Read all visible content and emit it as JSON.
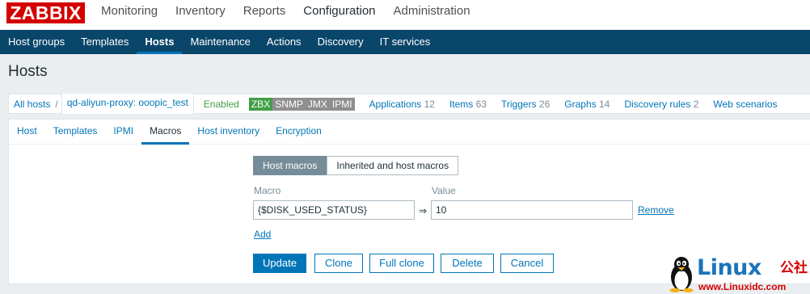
{
  "logo": "ZABBIX",
  "main_menu": [
    "Monitoring",
    "Inventory",
    "Reports",
    "Configuration",
    "Administration"
  ],
  "main_menu_active": "Configuration",
  "sub_menu": [
    "Host groups",
    "Templates",
    "Hosts",
    "Maintenance",
    "Actions",
    "Discovery",
    "IT services"
  ],
  "sub_menu_active": "Hosts",
  "page_title": "Hosts",
  "host_nav": {
    "all_hosts": "All hosts",
    "separator": "/",
    "host_name": "qd-aliyun-proxy: ooopic_test",
    "status": "Enabled",
    "availability": [
      "ZBX",
      "SNMP",
      "JMX",
      "IPMI"
    ],
    "links": [
      {
        "label": "Applications",
        "count": "12"
      },
      {
        "label": "Items",
        "count": "63"
      },
      {
        "label": "Triggers",
        "count": "26"
      },
      {
        "label": "Graphs",
        "count": "14"
      },
      {
        "label": "Discovery rules",
        "count": "2"
      },
      {
        "label": "Web scenarios",
        "count": ""
      }
    ]
  },
  "tabs": [
    "Host",
    "Templates",
    "IPMI",
    "Macros",
    "Host inventory",
    "Encryption"
  ],
  "tab_active": "Macros",
  "macro_mode": {
    "host_macros": "Host macros",
    "inherited": "Inherited and host macros"
  },
  "macro_form": {
    "macro_label": "Macro",
    "value_label": "Value",
    "macro_value": "{$DISK_USED_STATUS}",
    "arrow": "⇒",
    "value_value": "10",
    "remove_label": "Remove",
    "add_label": "Add"
  },
  "buttons": {
    "update": "Update",
    "clone": "Clone",
    "full_clone": "Full clone",
    "delete": "Delete",
    "cancel": "Cancel"
  },
  "watermark": {
    "brand": "Linux",
    "brand_cn": "公社",
    "site": "www.Linuxidc.com"
  },
  "colors": {
    "logo_bg": "#d40000",
    "subbar_bg": "#0a466a",
    "link": "#0275b8",
    "enabled": "#429e47",
    "zbx_badge": "#429e47",
    "inactive_badge": "#8f8f8f"
  }
}
